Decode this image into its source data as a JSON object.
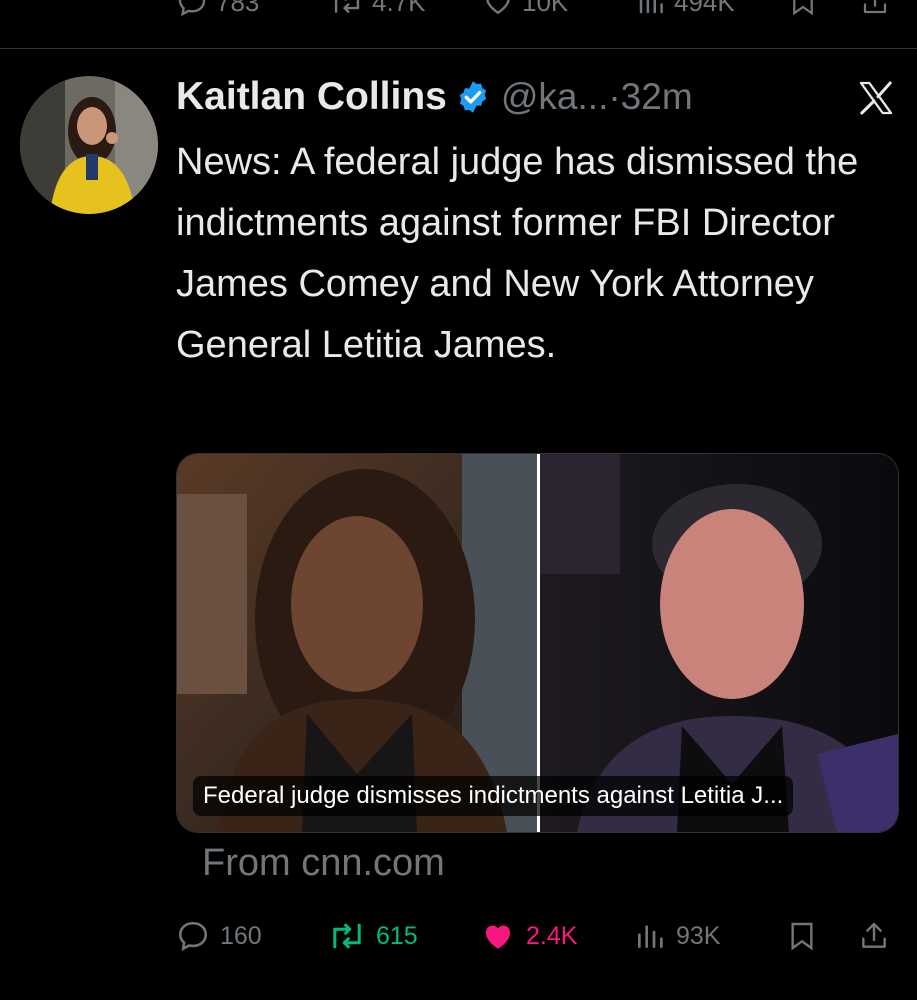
{
  "previous_tweet": {
    "replies": "783",
    "reposts": "4.7K",
    "likes": "10K",
    "views": "494K"
  },
  "tweet": {
    "author_name": "Kaitlan Collins",
    "handle_time": "@ka...·32m",
    "text": "News: A federal judge has dismissed the indictments against former FBI Director James Comey and New York Attorney General Letitia James.",
    "card_caption": "Federal judge dismisses indictments against Letitia J...",
    "card_source": "From cnn.com",
    "replies": "160",
    "reposts": "615",
    "likes": "2.4K",
    "views": "93K"
  },
  "colors": {
    "background": "#000000",
    "text_primary": "#e7e9ea",
    "text_secondary": "#71767b",
    "verified_blue": "#1d9bf0",
    "repost_green": "#00ba7c",
    "like_pink": "#f91880"
  },
  "icons": [
    "reply-icon",
    "repost-icon",
    "heart-icon",
    "views-icon",
    "bookmark-icon",
    "share-icon",
    "verified-badge-icon",
    "x-logo-icon"
  ]
}
